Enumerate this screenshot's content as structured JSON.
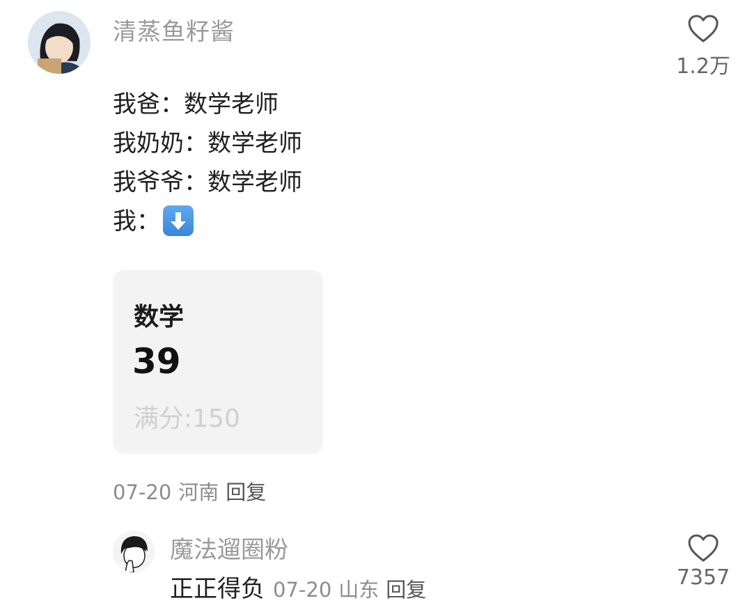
{
  "comment": {
    "username": "清蒸鱼籽酱",
    "like_count": "1.2万",
    "lines": [
      "我爸：数学老师",
      "我奶奶：数学老师",
      "我爷爷：数学老师",
      "我："
    ],
    "emoji": "down-arrow-emoji",
    "score_card": {
      "subject": "数学",
      "score": "39",
      "full_score": "满分:150"
    },
    "date": "07-20",
    "location": "河南",
    "reply_label": "回复"
  },
  "reply": {
    "username": "魔法遛圈粉",
    "text": "正正得负",
    "date": "07-20",
    "location": "山东",
    "reply_label": "回复",
    "like_count": "7357"
  },
  "colors": {
    "username": "#9a9a9a",
    "text": "#1f1f1f",
    "meta": "#8c8c8c",
    "card_bg": "#f3f3f3",
    "emoji_blue": "#3a86d8"
  }
}
